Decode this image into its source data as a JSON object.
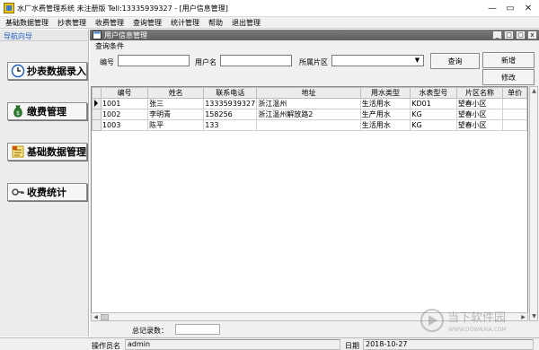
{
  "window": {
    "title": "水厂水费管理系统 未注册版 Tell:13335939327 - [用户信息管理]",
    "controls": [
      "—",
      "▭",
      "✕"
    ]
  },
  "menu": [
    "基础数据管理",
    "抄表管理",
    "收费管理",
    "查询管理",
    "统计管理",
    "帮助",
    "退出管理"
  ],
  "nav": {
    "header": "导航向导",
    "buttons": [
      {
        "label": "抄表数据录入",
        "icon": "clock-icon"
      },
      {
        "label": "缴费管理",
        "icon": "money-bag-icon"
      },
      {
        "label": "基础数据管理",
        "icon": "data-sheet-icon"
      },
      {
        "label": "收费统计",
        "icon": "key-icon"
      }
    ]
  },
  "child": {
    "title": "用户信息管理",
    "controls": [
      "_",
      "□",
      "▢",
      "x"
    ],
    "query_group": "查询条件",
    "fields": {
      "code_label": "编号",
      "user_label": "用户名",
      "area_label": "所属片区",
      "code_value": "",
      "user_value": "",
      "area_value": ""
    },
    "buttons": {
      "search": "查询",
      "new": "新增",
      "edit": "修改"
    },
    "grid": {
      "columns": [
        "编号",
        "姓名",
        "联系电话",
        "地址",
        "用水类型",
        "水表型号",
        "片区名称",
        "单价"
      ],
      "rows": [
        [
          "1001",
          "张三",
          "13335939327",
          "浙江温州",
          "生活用水",
          "KD01",
          "望春小区",
          ""
        ],
        [
          "1002",
          "李明青",
          "158256",
          "浙江温州解放路2",
          "生产用水",
          "KG",
          "望春小区",
          ""
        ],
        [
          "1003",
          "陈平",
          "133",
          "",
          "生活用水",
          "KG",
          "望春小区",
          ""
        ]
      ],
      "selected_row": 0
    },
    "total_label": "总记录数：",
    "total_value": ""
  },
  "status": {
    "operator_label": "操作员名",
    "operator_value": "admin",
    "date_label": "日期",
    "date_value": "2018-10-27"
  },
  "watermark": {
    "text_big": "当下软件园",
    "text_small": "WWW.DOWNXIA.COM"
  },
  "colors": {
    "accent_blue": "#1f5fbf",
    "child_title_bg": "#6b6b6b",
    "face": "#f0f0f0"
  }
}
